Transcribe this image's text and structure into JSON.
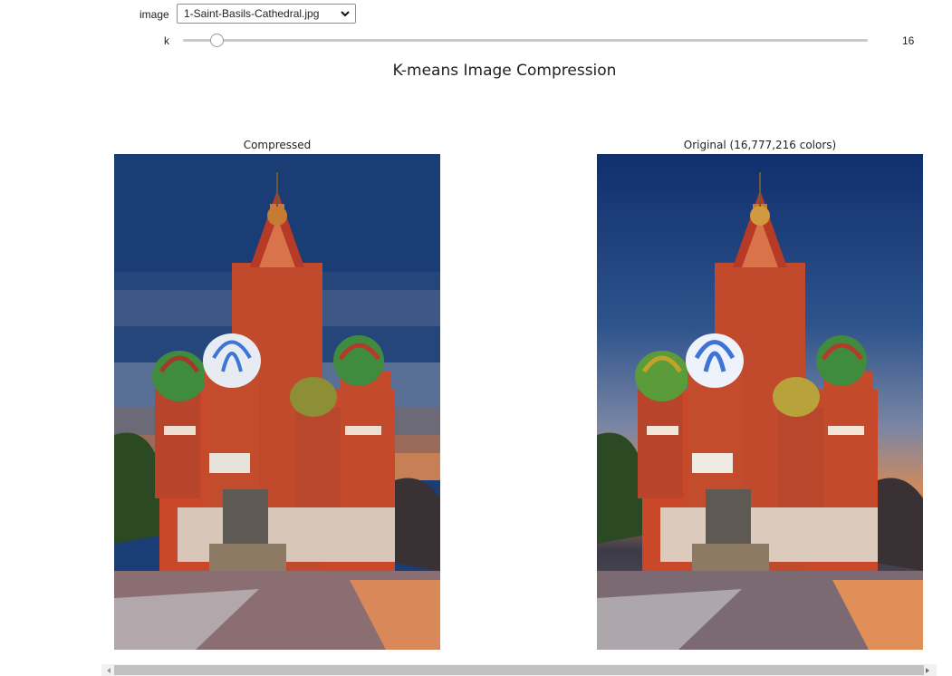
{
  "controls": {
    "image_label": "image",
    "image_selected": "1-Saint-Basils-Cathedral.jpg",
    "k_label": "k",
    "k_value": "16",
    "k_fraction": 0.05
  },
  "figure": {
    "title": "K-means Image Compression",
    "left_title": "Compressed",
    "right_title": "Original (16,777,216 colors)"
  },
  "colors": {
    "sky_top": "#1b3d75",
    "sky_mid": "#5a6f95",
    "dusk": "#c77f55",
    "brick": "#c9482a",
    "ground": "#8a6e72",
    "green_dome": "#3f8c3f",
    "blue_dome": "#3d74d6"
  }
}
